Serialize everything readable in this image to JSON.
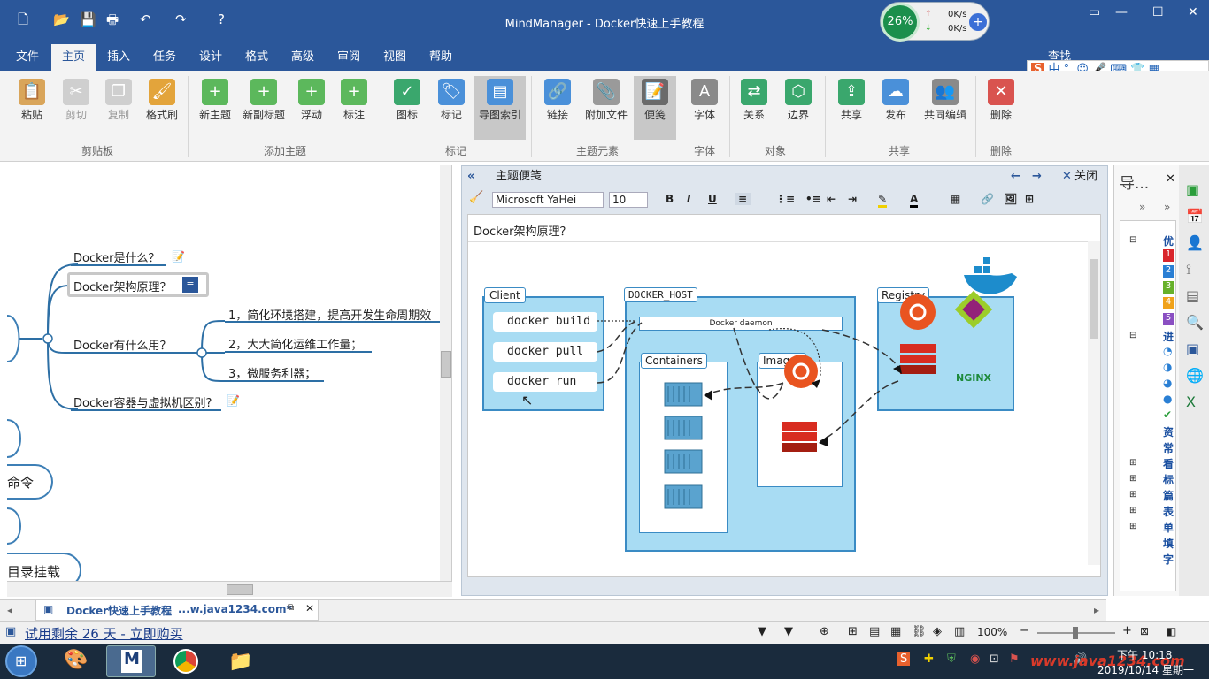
{
  "app": {
    "title": "MindManager - Docker快速上手教程"
  },
  "netwidget": {
    "percent": "26%",
    "up": "0K/s",
    "down": "0K/s"
  },
  "menu": {
    "items": [
      "文件",
      "主页",
      "插入",
      "任务",
      "设计",
      "格式",
      "高级",
      "审阅",
      "视图",
      "帮助"
    ],
    "search": "查找"
  },
  "ribbon": {
    "buttons": [
      "粘贴",
      "剪切",
      "复制",
      "格式刷",
      "新主题",
      "新副标题",
      "浮动",
      "标注",
      "图标",
      "标记",
      "导图索引",
      "链接",
      "附加文件",
      "便笺",
      "字体",
      "关系",
      "边界",
      "共享",
      "发布",
      "共同编辑",
      "删除"
    ],
    "groups": [
      "剪贴板",
      "添加主题",
      "标记",
      "主题元素",
      "字体",
      "对象",
      "共享",
      "删除"
    ]
  },
  "map": {
    "topics": [
      "Docker是什么？",
      "Docker架构原理？",
      "Docker有什么用？",
      "Docker容器与虚拟机区别?"
    ],
    "subtopics": [
      "1，简化环境搭建，提高开发生命周期效",
      "2，大大简化运维工作量；",
      "3，微服务利器；"
    ],
    "bubbles": [
      "命令",
      "目录挂载"
    ]
  },
  "notes": {
    "panel_title": "主题便笺",
    "close_label": "关闭",
    "font": "Microsoft YaHei",
    "size": "10",
    "heading": "Docker架构原理？",
    "diagram": {
      "client": "Client",
      "host": "DOCKER_HOST",
      "registry": "Registry",
      "daemon": "Docker daemon",
      "containers": "Containers",
      "images": "Images",
      "commands": [
        "docker build",
        "docker pull",
        "docker run"
      ],
      "nginx": "NGINX"
    }
  },
  "rightpanel": {
    "title": "导...",
    "chars": [
      "优",
      "进",
      "资",
      "常",
      "看",
      "标",
      "篇",
      "表",
      "单",
      "填",
      "字"
    ],
    "nums": [
      "1",
      "2",
      "3",
      "4",
      "5"
    ]
  },
  "doctab": {
    "label": "Docker快速上手教程",
    "site": "...w.java1234.com*"
  },
  "status": {
    "trial": "试用剩余 26 天 - 立即购买",
    "zoom": "100%"
  },
  "taskbar": {
    "time": "下午 10:18",
    "date": "2019/10/14 星期一",
    "watermark": "www.java1234.com"
  },
  "colors": {
    "brand": "#2b579a",
    "diagram_fill": "#a8dcf3",
    "diagram_border": "#3a8bc4"
  }
}
